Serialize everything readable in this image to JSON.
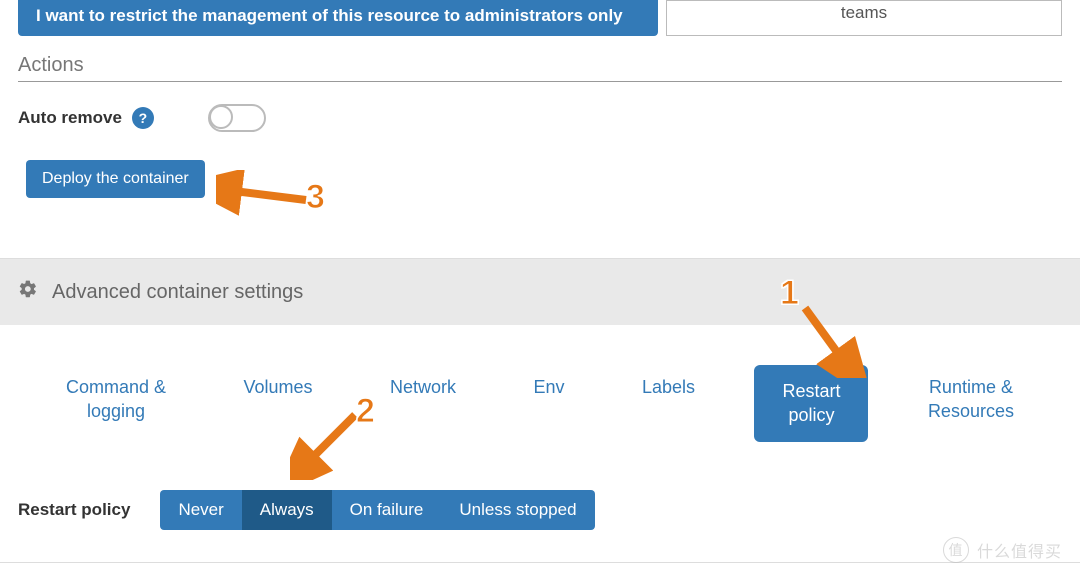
{
  "banner": {
    "text": "I want to restrict the management of this resource to administrators only",
    "side_text": "teams"
  },
  "actions": {
    "heading": "Actions",
    "auto_remove_label": "Auto remove",
    "deploy_label": "Deploy the container"
  },
  "advanced": {
    "heading": "Advanced container settings",
    "tabs": [
      {
        "label": "Command &\nlogging"
      },
      {
        "label": "Volumes"
      },
      {
        "label": "Network"
      },
      {
        "label": "Env"
      },
      {
        "label": "Labels"
      },
      {
        "label": "Restart\npolicy",
        "active": true
      },
      {
        "label": "Runtime &\nResources"
      }
    ]
  },
  "restart_policy": {
    "label": "Restart policy",
    "options": [
      "Never",
      "Always",
      "On failure",
      "Unless stopped"
    ],
    "selected": "Always"
  },
  "annotations": {
    "one": "1",
    "two": "2",
    "three": "3"
  },
  "watermark": {
    "text": "什么值得买"
  }
}
